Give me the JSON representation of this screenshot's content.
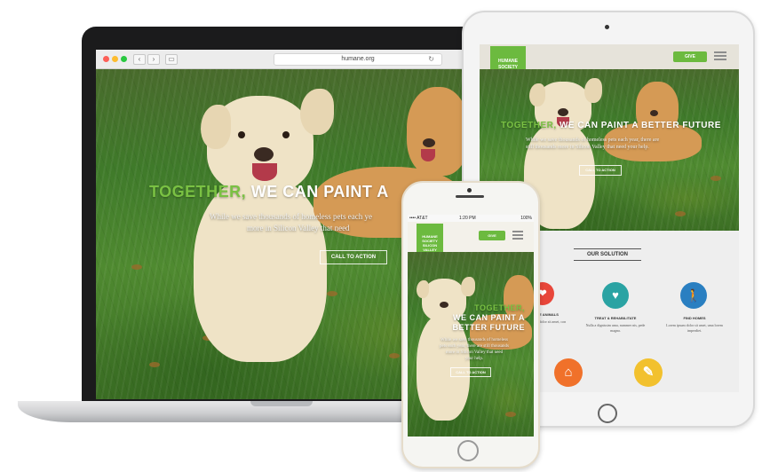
{
  "laptop": {
    "browser": {
      "address": "humane.org",
      "back_glyph": "‹",
      "forward_glyph": "›",
      "sidebar_glyph": "▭",
      "reload_glyph": "↻"
    },
    "hero": {
      "headline_green": "TOGETHER,",
      "headline_white": "WE CAN PAINT A",
      "sub_line1": "While we save thousands of homeless pets each ye",
      "sub_line2": "more in Silicon Valley that need",
      "cta": "CALL TO ACTION"
    }
  },
  "tablet": {
    "logo": "HUMANE SOCIETY SILICON VALLEY",
    "nav_button": "GIVE",
    "hero": {
      "headline_green": "TOGETHER,",
      "headline_white": "WE CAN PAINT A BETTER FUTURE",
      "sub_line1": "While we save thousands of homeless pets each year, there are",
      "sub_line2": "still thousands more in Silicon Valley that need your help.",
      "cta": "CALL TO ACTION"
    },
    "solution": {
      "title": "OUR SOLUTION",
      "items": [
        {
          "label": "RESCUE ANIMALS",
          "text": "Lorem ipsum dolor sit amet, con",
          "icon": "rescue-icon"
        },
        {
          "label": "TREAT & REHABILITATE",
          "text": "Nulla a dignissim uma, nummer nis, pede magna.",
          "icon": "heart-hands-icon"
        },
        {
          "label": "FIND HOMES",
          "text": "Lorem ipsum dolor sit amet, uma lorem imperdiet.",
          "icon": "person-dog-icon"
        }
      ],
      "colors": {
        "teal": "#2aa3a3",
        "blue": "#2a7fc1",
        "orange": "#f0712a",
        "yellow": "#f2c12e",
        "red": "#e8463a"
      }
    }
  },
  "phone": {
    "status": {
      "carrier": "•••• AT&T",
      "time": "1:20 PM",
      "battery": "100%"
    },
    "logo": "HUMANE SOCIETY SILICON VALLEY",
    "nav_button": "GIVE",
    "hero": {
      "headline_green": "TOGETHER,",
      "headline_white_1": "WE CAN PAINT A",
      "headline_white_2": "BETTER FUTURE",
      "sub_line1": "While we save thousands of homeless",
      "sub_line2": "pets each year, there are still thousands",
      "sub_line3": "more in Silicon Valley that need",
      "sub_line4": "your help.",
      "cta": "CALL TO ACTION"
    }
  },
  "brand": {
    "green": "#6cba3f",
    "headline_green": "#7ac143"
  }
}
